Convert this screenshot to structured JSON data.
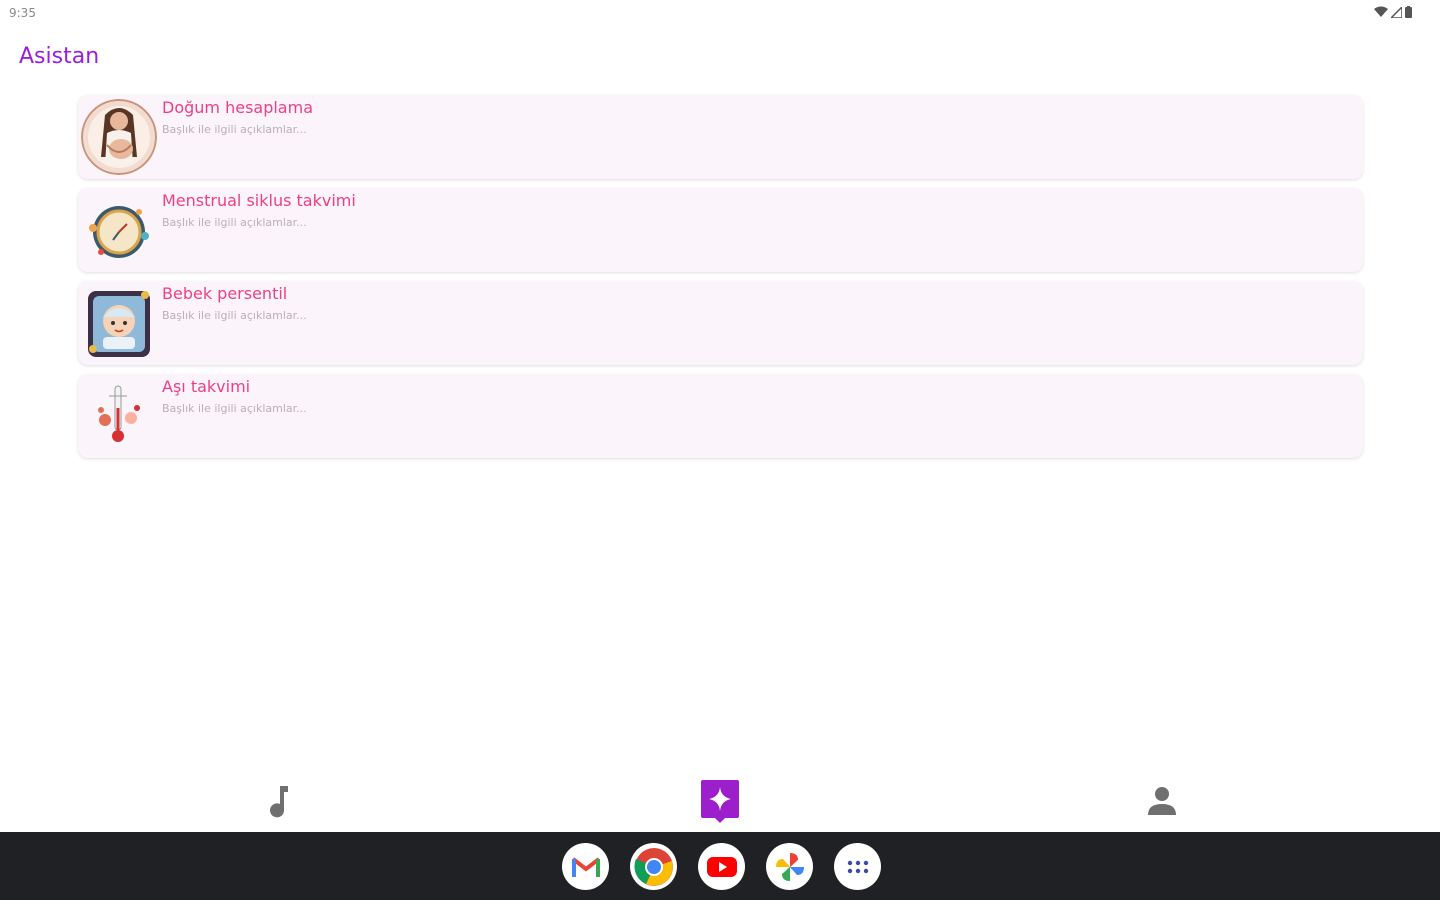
{
  "status_bar": {
    "time": "9:35"
  },
  "app": {
    "title": "Asistan"
  },
  "cards": [
    {
      "title": "Doğum hesaplama",
      "description": "Başlık ile ilgili açıklamlar...",
      "thumbnail": "pregnant-woman-illustration"
    },
    {
      "title": "Menstrual siklus takvimi",
      "description": "Başlık ile ilgili açıklamlar...",
      "thumbnail": "cycle-clock-illustration"
    },
    {
      "title": "Bebek persentil",
      "description": "Başlık ile ilgili açıklamlar...",
      "thumbnail": "baby-illustration"
    },
    {
      "title": "Aşı takvimi",
      "description": "Başlık ile ilgili açıklamlar...",
      "thumbnail": "vaccine-thermometer-illustration"
    }
  ],
  "bottom_nav": [
    {
      "icon": "music-note-icon",
      "active": false
    },
    {
      "icon": "sparkle-chat-icon",
      "active": true
    },
    {
      "icon": "person-icon",
      "active": false
    }
  ],
  "taskbar_apps": [
    {
      "icon": "gmail-icon"
    },
    {
      "icon": "chrome-icon"
    },
    {
      "icon": "youtube-icon"
    },
    {
      "icon": "photos-icon"
    },
    {
      "icon": "app-drawer-icon"
    }
  ],
  "colors": {
    "accent": "#9a1ee0",
    "card_title": "#ee3f86",
    "card_background": "#fbf4fa",
    "nav_active": "#9b1fcb",
    "nav_inactive": "#6f6f6f",
    "taskbar": "#202124"
  }
}
